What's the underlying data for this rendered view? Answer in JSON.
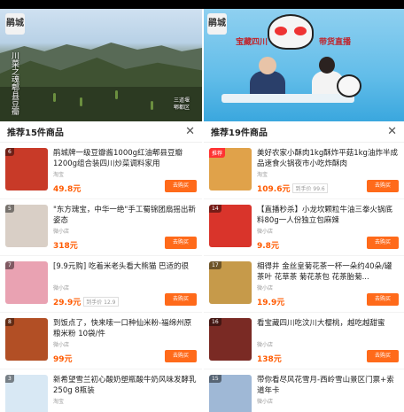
{
  "left": {
    "video": {
      "logo_text": "鹃城",
      "vertical_caption": "川菜之魂郫县豆瓣",
      "corner_caption": "三道堰\n郫都区"
    },
    "list": {
      "title": "推荐15件商品",
      "items": [
        {
          "num": "6",
          "hot": false,
          "name": "鹃城牌一级豆瓣酱1000g红油郫县豆瓣1200g组合装四川炒菜调料家用",
          "shop": "淘宝",
          "price": "49.8元",
          "tag": "",
          "button": "去购买",
          "thumb_color": "#c83a28"
        },
        {
          "num": "5",
          "hot": false,
          "name": "\"东方瑰宝，中华一绝\"手工蜀锦团扇摇出新姿态",
          "shop": "微小店",
          "price": "318元",
          "tag": "",
          "button": "去购买",
          "thumb_color": "#d9cfc6"
        },
        {
          "num": "7",
          "hot": false,
          "name": "[9.9元购] 吃着米老头看大熊猫 巴适的很",
          "shop": "微小店",
          "price": "29.9元",
          "tag": "到手价 12.9",
          "button": "去购买",
          "thumb_color": "#e9a2b2"
        },
        {
          "num": "8",
          "hot": false,
          "name": "到饭点了，快来嗦一口种仙米粉-福绵州原粮米粉 10袋/件",
          "shop": "微小店",
          "price": "99元",
          "tag": "",
          "button": "去购买",
          "thumb_color": "#b24f25"
        },
        {
          "num": "3",
          "hot": false,
          "name": "新希望雪兰初心酸奶塑瓶酸牛奶风味发酵乳250g 8瓶装",
          "shop": "淘宝",
          "price": "",
          "tag": "",
          "button": "",
          "thumb_color": "#d8e8f4"
        }
      ]
    }
  },
  "right": {
    "video": {
      "logo_text": "鹃城",
      "banner_text": "宝藏四川",
      "banner_text2": "带货直播"
    },
    "list": {
      "title": "推荐19件商品",
      "items": [
        {
          "num": "推荐",
          "hot": true,
          "name": "美好农家小酥肉1kg酥炸平菇1kg油炸半成品速食火锅夜市小吃炸酥肉",
          "shop": "淘宝",
          "price": "109.6元",
          "tag": "到手价 99.6",
          "button": "去购买",
          "thumb_color": "#e0a24a"
        },
        {
          "num": "14",
          "hot": false,
          "name": "【直播秒杀】小龙坎颗粒牛油三拳火锅底料80g一人份独立包麻辣",
          "shop": "微小店",
          "price": "9.8元",
          "tag": "",
          "button": "去购买",
          "thumb_color": "#d9342b"
        },
        {
          "num": "17",
          "hot": false,
          "name": "相得井 金丝皇菊花茶一杯一朵约40朵/罐 茶叶 花草茶 菊花茶包 花茶胎菊...",
          "shop": "微小店",
          "price": "19.9元",
          "tag": "",
          "button": "去购买",
          "thumb_color": "#c69a4a"
        },
        {
          "num": "16",
          "hot": false,
          "name": "看宝藏四川吃汶川大樱桃，越吃越甜蜜",
          "shop": "微小店",
          "price": "138元",
          "tag": "",
          "button": "去购买",
          "thumb_color": "#7a2a24"
        },
        {
          "num": "15",
          "hot": false,
          "name": "带你看尽风花雪月-西岭雪山景区门票+索道年卡",
          "shop": "微小店",
          "price": "",
          "tag": "",
          "button": "",
          "thumb_color": "#9fb8d6"
        }
      ]
    }
  }
}
